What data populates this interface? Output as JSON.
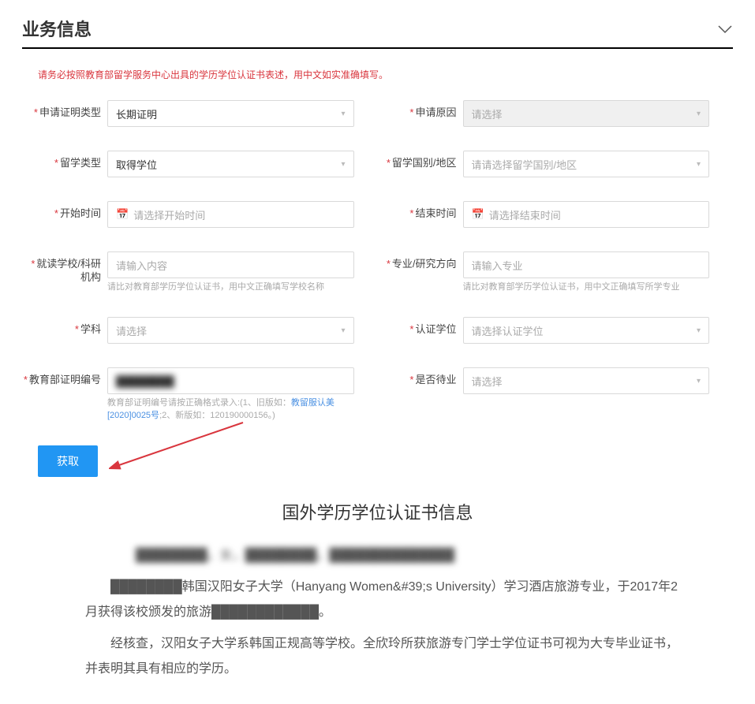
{
  "header": {
    "title": "业务信息"
  },
  "warning": "请务必按照教育部留学服务中心出具的学历学位认证书表述，用中文如实准确填写。",
  "fields": {
    "certType": {
      "label": "申请证明类型",
      "value": "长期证明"
    },
    "reason": {
      "label": "申请原因",
      "placeholder": "请选择"
    },
    "studyType": {
      "label": "留学类型",
      "value": "取得学位"
    },
    "country": {
      "label": "留学国别/地区",
      "placeholder": "请请选择留学国别/地区"
    },
    "startDate": {
      "label": "开始时间",
      "placeholder": "请选择开始时间"
    },
    "endDate": {
      "label": "结束时间",
      "placeholder": "请选择结束时间"
    },
    "school": {
      "label": "就读学校/科研机构",
      "placeholder": "请输入内容",
      "hint": "请比对教育部学历学位认证书，用中文正确填写学校名称"
    },
    "major": {
      "label": "专业/研究方向",
      "placeholder": "请输入专业",
      "hint": "请比对教育部学历学位认证书，用中文正确填写所学专业"
    },
    "subject": {
      "label": "学科",
      "placeholder": "请选择"
    },
    "degree": {
      "label": "认证学位",
      "placeholder": "请选择认证学位"
    },
    "certNo": {
      "label": "教育部证明编号",
      "value": "████████",
      "hintPrefix": "教育部证明编号请按正确格式录入:(1、旧版如：",
      "hintLink": "教留服认美[2020]0025号",
      "hintSuffix": ";2、新版如：120190000156。)"
    },
    "pending": {
      "label": "是否待业",
      "placeholder": "请选择"
    }
  },
  "fetchBtn": "获取",
  "cert": {
    "title": "国外学历学位认证书信息",
    "line1a": "████████，女，████████，██████████████",
    "line2a": "████████韩国汉阳女子大学（Hanyang Women&#39;s University）学习酒店旅游专业，于2017年2月获得该校颁发的旅游████████████。",
    "line3": "经核查，汉阳女子大学系韩国正规高等学校。全欣玲所获旅游专门学士学位证书可视为大专毕业证书，并表明其具有相应的学历。"
  }
}
